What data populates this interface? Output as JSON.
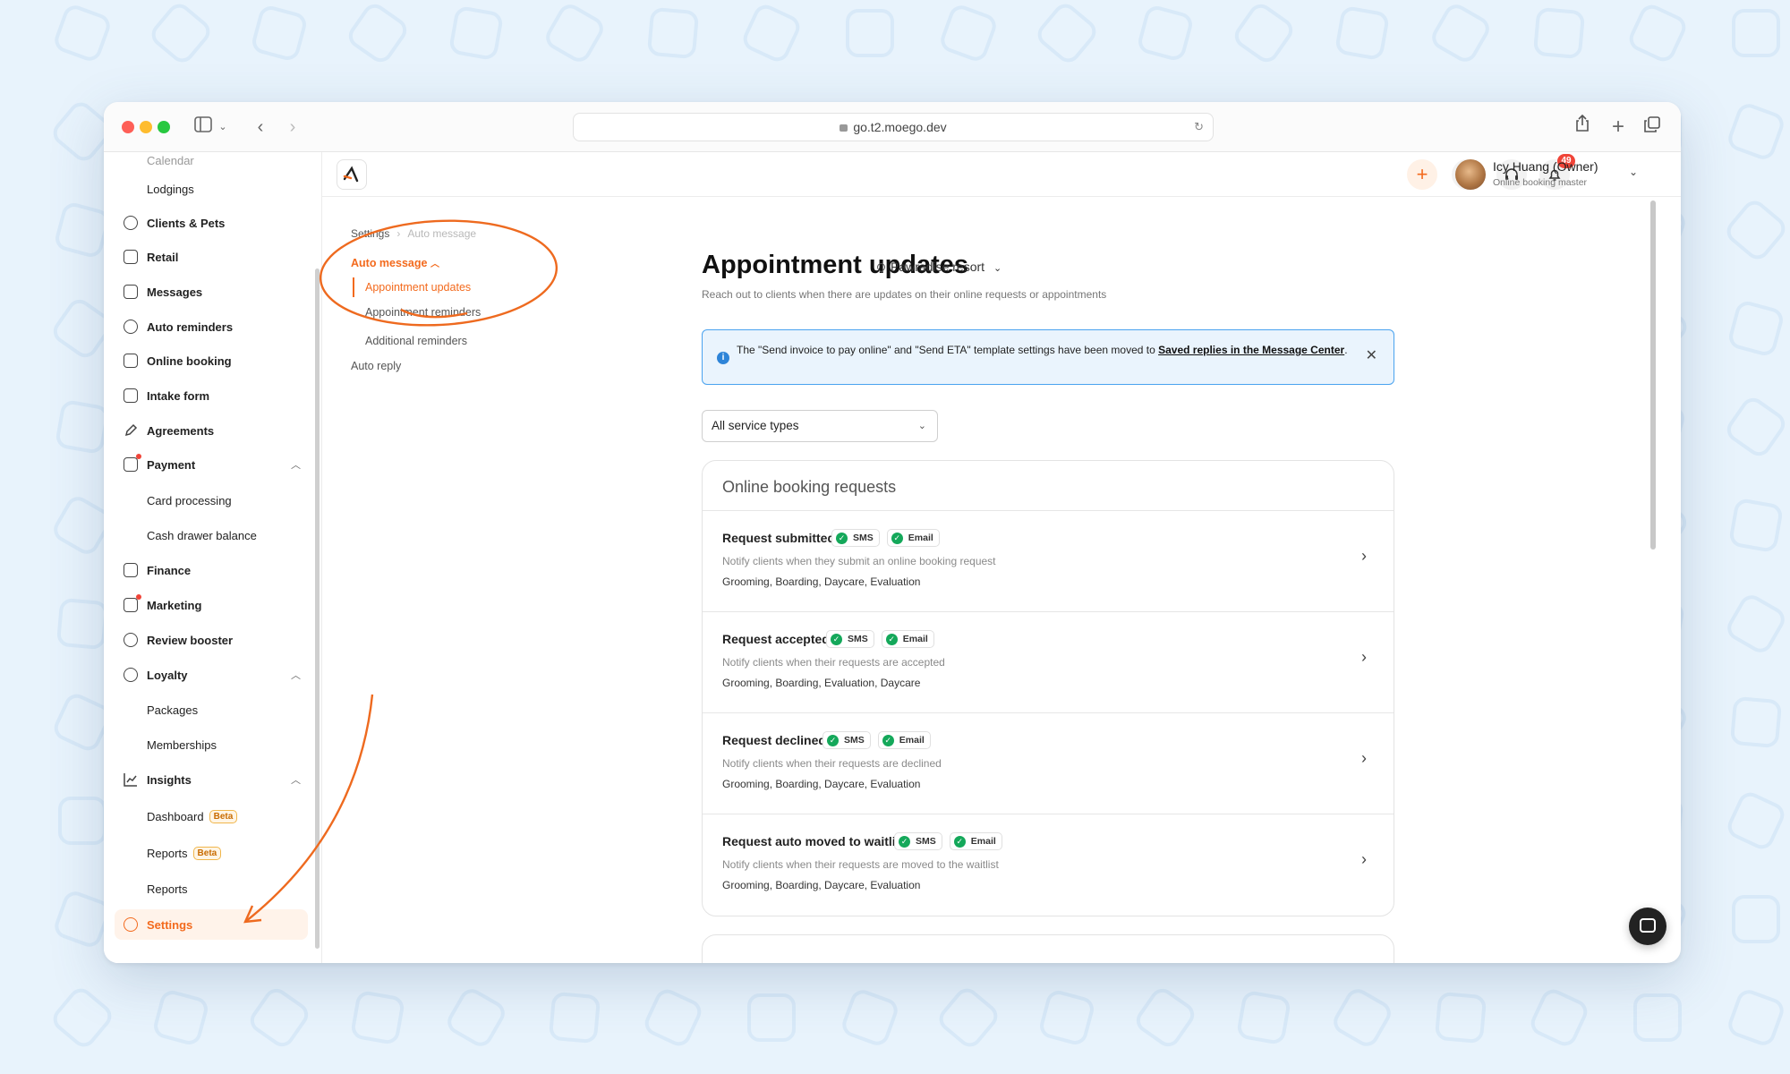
{
  "browser": {
    "url": "go.t2.moego.dev"
  },
  "sidebar": {
    "items": [
      {
        "label": "Calendar",
        "name": "sidebar-item-calendar"
      },
      {
        "label": "Lodgings",
        "name": "sidebar-item-lodgings"
      },
      {
        "label": "Clients & Pets",
        "name": "sidebar-item-clients-pets"
      },
      {
        "label": "Retail",
        "name": "sidebar-item-retail"
      },
      {
        "label": "Messages",
        "name": "sidebar-item-messages"
      },
      {
        "label": "Auto reminders",
        "name": "sidebar-item-auto-reminders"
      },
      {
        "label": "Online booking",
        "name": "sidebar-item-online-booking"
      },
      {
        "label": "Intake form",
        "name": "sidebar-item-intake-form"
      },
      {
        "label": "Agreements",
        "name": "sidebar-item-agreements"
      },
      {
        "label": "Payment",
        "name": "sidebar-item-payment"
      },
      {
        "label": "Card processing",
        "name": "sidebar-item-card-processing"
      },
      {
        "label": "Cash drawer balance",
        "name": "sidebar-item-cash-drawer"
      },
      {
        "label": "Finance",
        "name": "sidebar-item-finance"
      },
      {
        "label": "Marketing",
        "name": "sidebar-item-marketing"
      },
      {
        "label": "Review booster",
        "name": "sidebar-item-review-booster"
      },
      {
        "label": "Loyalty",
        "name": "sidebar-item-loyalty"
      },
      {
        "label": "Packages",
        "name": "sidebar-item-packages"
      },
      {
        "label": "Memberships",
        "name": "sidebar-item-memberships"
      },
      {
        "label": "Insights",
        "name": "sidebar-item-insights"
      },
      {
        "label": "Dashboard",
        "name": "sidebar-item-dashboard"
      },
      {
        "label": "Reports",
        "name": "sidebar-item-reports-beta"
      },
      {
        "label": "Reports",
        "name": "sidebar-item-reports"
      },
      {
        "label": "Settings",
        "name": "sidebar-item-settings"
      }
    ],
    "beta_label": "Beta"
  },
  "header": {
    "notification_count": "49",
    "user_name": "Icy Huang (Owner)",
    "user_role": "Online booking master"
  },
  "settings_nav": {
    "breadcrumb_root": "Settings",
    "breadcrumb_current": "Auto message",
    "group_label": "Auto message",
    "items": [
      "Appointment updates",
      "Appointment reminders",
      "Additional reminders"
    ],
    "auto_reply": "Auto reply"
  },
  "main": {
    "title": "Appointment updates",
    "location": "Pawradise resort",
    "subtitle": "Reach out to clients when there are updates on their online requests or appointments",
    "banner_text": "The \"Send invoice to pay online\" and \"Send ETA\" template settings have been moved to ",
    "banner_link": "Saved replies in the Message Center",
    "banner_end": ".",
    "service_filter": "All service types",
    "card_title": "Online booking requests",
    "sms_label": "SMS",
    "email_label": "Email",
    "rows": [
      {
        "title": "Request submitted",
        "desc": "Notify clients when they submit an online booking request",
        "services": "Grooming, Boarding, Daycare, Evaluation"
      },
      {
        "title": "Request accepted",
        "desc": "Notify clients when their requests are accepted",
        "services": "Grooming, Boarding, Evaluation, Daycare"
      },
      {
        "title": "Request declined",
        "desc": "Notify clients when their requests are declined",
        "services": "Grooming, Boarding, Daycare, Evaluation"
      },
      {
        "title": "Request auto moved to waitlist",
        "desc": "Notify clients when their requests are moved to the waitlist",
        "services": "Grooming, Boarding, Daycare, Evaluation"
      }
    ]
  },
  "colors": {
    "accent": "#f36a1d",
    "background": "#e8f3fc",
    "success": "#14a85a",
    "info": "#4aa3ef"
  }
}
